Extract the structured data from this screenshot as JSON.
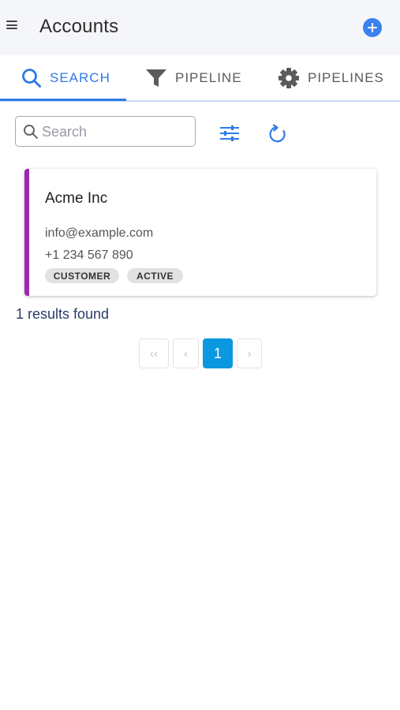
{
  "header": {
    "title": "Accounts",
    "menu_icon": "hamburger-menu-icon",
    "add_icon": "plus-circle-icon",
    "add_color": "#3a82f0"
  },
  "tabs": [
    {
      "label": "SEARCH",
      "icon": "search-icon",
      "active": true
    },
    {
      "label": "PIPELINE",
      "icon": "funnel-icon",
      "active": false
    },
    {
      "label": "PIPELINES",
      "icon": "gear-icon",
      "active": false
    }
  ],
  "accent_color": "#2f7ae5",
  "search": {
    "placeholder": "Search",
    "value": "",
    "filter_icon": "sliders-icon",
    "refresh_icon": "refresh-icon"
  },
  "results": {
    "items": [
      {
        "name": "Acme Inc",
        "email": "info@example.com",
        "phone": "+1 234 567 890",
        "tags": [
          "CUSTOMER",
          "ACTIVE"
        ],
        "accent_color": "#9c27b0"
      }
    ],
    "summary": "1 results found"
  },
  "pagination": {
    "first_label": "‹‹",
    "prev_label": "‹",
    "current_page": "1",
    "next_label": "›",
    "current_color": "#0b98e0"
  }
}
